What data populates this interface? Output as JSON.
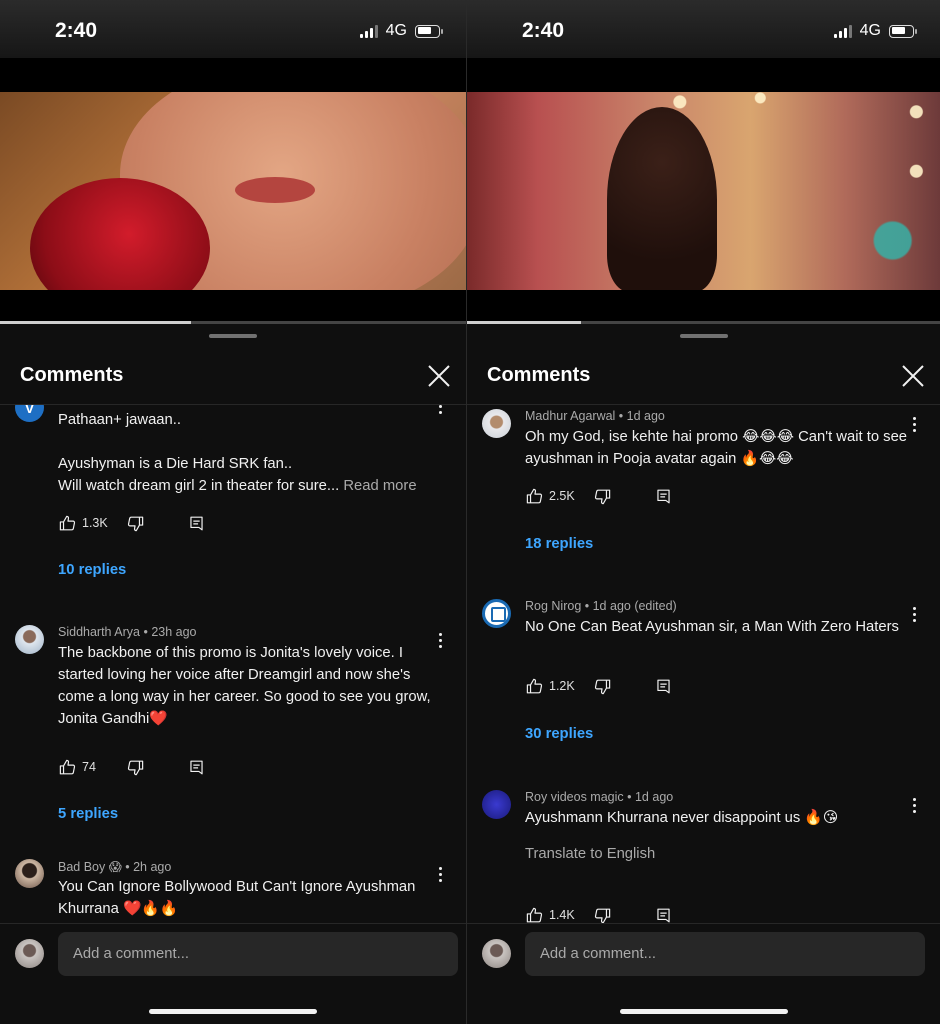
{
  "status_bar": {
    "time": "2:40",
    "network": "4G"
  },
  "colors": {
    "accent_blue": "#3ea6ff",
    "background": "#0f0f0f",
    "heart": "#e53935"
  },
  "screens": [
    {
      "video": {
        "progress_fraction": 0.41
      },
      "sheet": {
        "title": "Comments"
      },
      "comments": [
        {
          "avatar_letter": "V",
          "meta": "",
          "lines": [
            "Pathaan+ jawaan..",
            "",
            "Ayushyman is a Die Hard SRK fan..",
            "Will watch dream girl 2 in theater for sure..."
          ],
          "read_more": "Read more",
          "likes": "1.3K",
          "replies": "10 replies"
        },
        {
          "author": "Siddharth Arya",
          "time": "23h ago",
          "text": "The backbone of this promo is Jonita's lovely voice. I started loving her voice after Dreamgirl and now she's come a long way in her career. So good to see you grow, Jonita Gandhi❤️",
          "likes": "74",
          "replies": "5 replies"
        },
        {
          "author": "Bad Boy 😱",
          "time": "2h ago",
          "text": "You Can Ignore Bollywood But Can't Ignore Ayushman Khurrana ❤️🔥🔥"
        }
      ],
      "input": {
        "placeholder": "Add a comment..."
      }
    },
    {
      "video": {
        "progress_fraction": 0.24
      },
      "sheet": {
        "title": "Comments"
      },
      "comments": [
        {
          "author": "Madhur Agarwal",
          "time": "1d ago",
          "text": "Oh my God, ise kehte hai promo 😂😂😂 Can't wait to see ayushman in Pooja avatar again 🔥😂😂",
          "likes": "2.5K",
          "replies": "18 replies"
        },
        {
          "author": "Rog Nirog",
          "time": "1d ago (edited)",
          "text": "No One Can Beat Ayushman sir, a Man With Zero Haters",
          "likes": "1.2K",
          "replies": "30 replies"
        },
        {
          "author": "Roy videos magic",
          "time": "1d ago",
          "text": "Ayushmann Khurrana never disappoint us 🔥😘",
          "translate": "Translate to English",
          "likes": "1.4K"
        }
      ],
      "input": {
        "placeholder": "Add a comment..."
      }
    }
  ]
}
